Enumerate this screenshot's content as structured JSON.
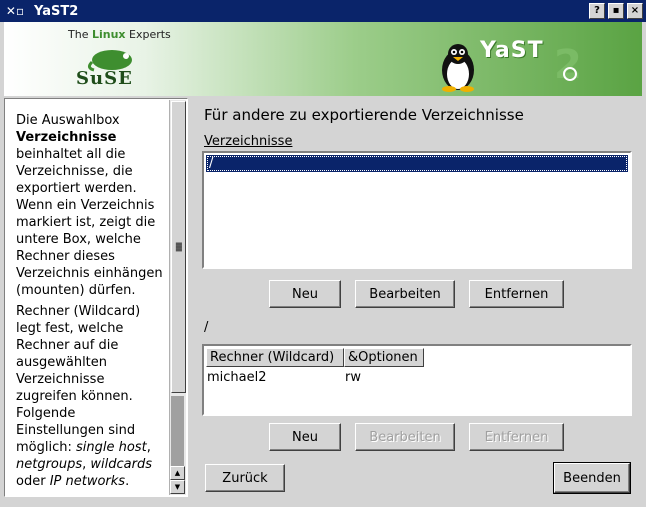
{
  "window": {
    "title": "YaST2",
    "icon": "x-window-icon",
    "controls": [
      "?",
      "▪",
      "×"
    ]
  },
  "banner": {
    "tagline_pre": "The ",
    "tagline_accent": "Linux",
    "tagline_post": " Experts",
    "logo_text": "SuSE",
    "brand_text": "YaST",
    "brand_accent_color": "#5aa343"
  },
  "help": {
    "paragraphs": [
      "<p>Die Auswahlbox <b>Verzeichnisse</b> beinhaltet all die Verzeichnisse, die exportiert werden. Wenn ein Verzeichnis markiert ist, zeigt die untere Box, welche Rechner dieses Verzeichnis einhängen (mounten) dürfen.</p>",
      "<p>Rechner (Wildcard) legt fest, welche Rechner auf die ausgewählten Verzeichnisse zugreifen können. Folgende Einstellungen sind möglich: <i>single host</i>, <i>netgroups</i>, <i>wildcards</i> oder <i>IP networks</i>.</p>"
    ]
  },
  "main": {
    "heading": "Für andere zu exportierende Verzeichnisse",
    "dirs_label": "Verzeichnisse",
    "dirs_list": [
      "/"
    ],
    "dir_buttons": {
      "new": "Neu",
      "edit": "Bearbeiten",
      "remove": "Entfernen"
    },
    "selected_path": "/",
    "hosts_table": {
      "columns": [
        "Rechner (Wildcard)",
        "&Optionen"
      ],
      "rows": [
        [
          "michael2",
          "rw"
        ]
      ]
    },
    "host_buttons": {
      "new": "Neu",
      "edit": "Bearbeiten",
      "remove": "Entfernen"
    },
    "back": "Zurück",
    "finish": "Beenden"
  }
}
